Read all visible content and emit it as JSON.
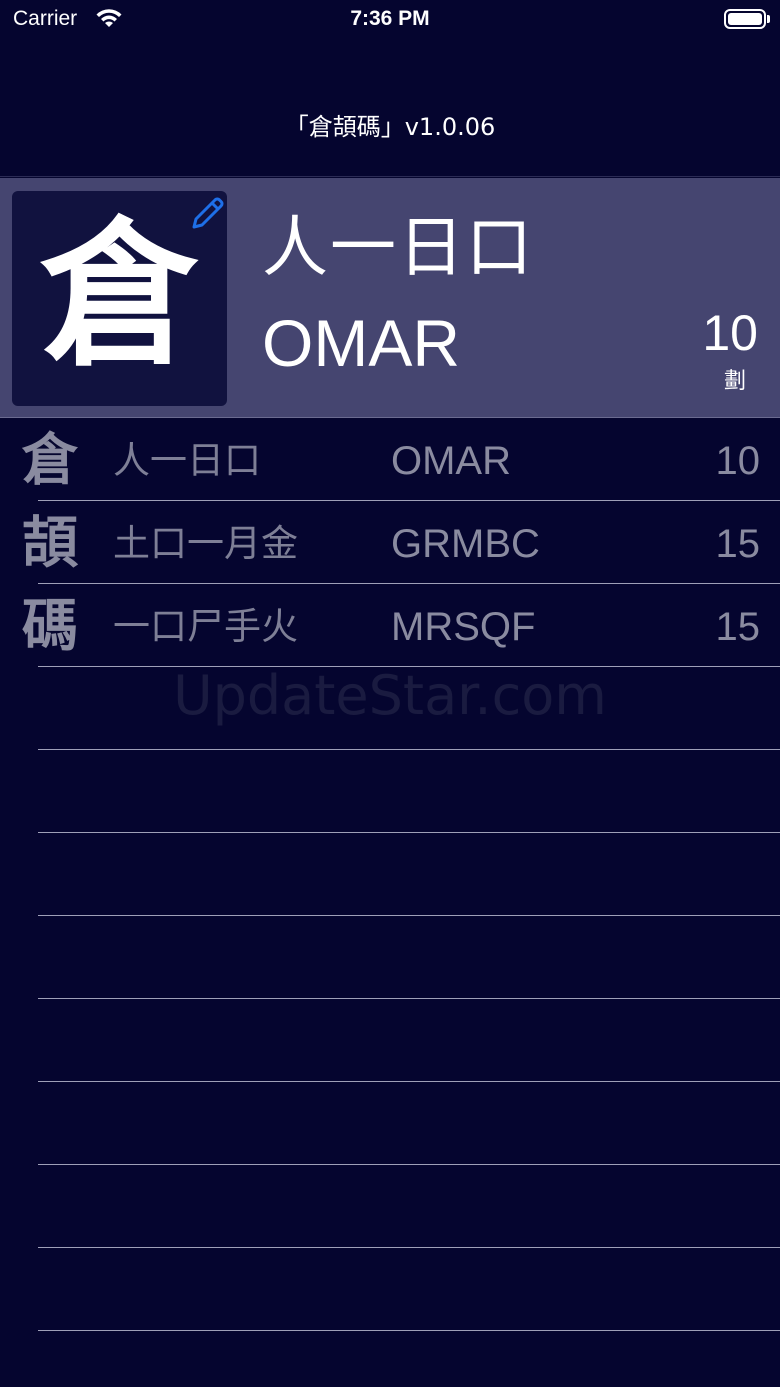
{
  "status_bar": {
    "carrier": "Carrier",
    "time": "7:36 PM",
    "wifi_icon": "wifi-icon",
    "battery_icon": "battery-icon"
  },
  "nav": {
    "title": "「倉頡碼」v1.0.06"
  },
  "header": {
    "character": "倉",
    "radicals": "人一日口",
    "code": "OMAR",
    "strokes": "10",
    "strokes_unit": "劃",
    "edit_icon": "pencil-icon",
    "accent_color": "#1e6fe8"
  },
  "rows": [
    {
      "character": "倉",
      "radicals": "人一日口",
      "code": "OMAR",
      "strokes": "10"
    },
    {
      "character": "頡",
      "radicals": "土口一月金",
      "code": "GRMBC",
      "strokes": "15"
    },
    {
      "character": "碼",
      "radicals": "一口尸手火",
      "code": "MRSQF",
      "strokes": "15"
    },
    {
      "character": "",
      "radicals": "",
      "code": "",
      "strokes": ""
    },
    {
      "character": "",
      "radicals": "",
      "code": "",
      "strokes": ""
    },
    {
      "character": "",
      "radicals": "",
      "code": "",
      "strokes": ""
    },
    {
      "character": "",
      "radicals": "",
      "code": "",
      "strokes": ""
    },
    {
      "character": "",
      "radicals": "",
      "code": "",
      "strokes": ""
    },
    {
      "character": "",
      "radicals": "",
      "code": "",
      "strokes": ""
    },
    {
      "character": "",
      "radicals": "",
      "code": "",
      "strokes": ""
    },
    {
      "character": "",
      "radicals": "",
      "code": "",
      "strokes": ""
    }
  ],
  "watermark": "UpdateStar.com",
  "colors": {
    "background": "#05052f",
    "header_background": "#454570",
    "char_box": "#11123f"
  }
}
